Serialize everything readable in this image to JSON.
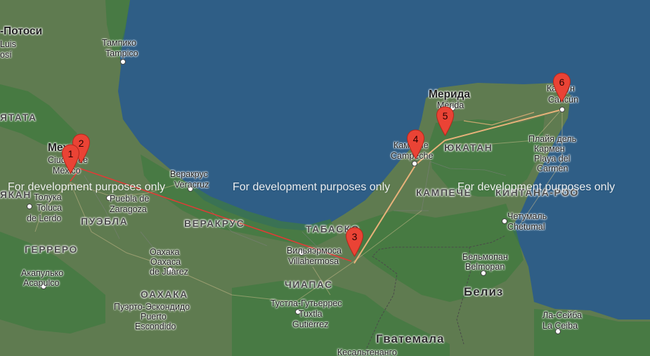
{
  "map": {
    "watermark": "For development purposes only",
    "colors": {
      "water": "#2f5e86",
      "land": "#5d7a4f",
      "forest": "#3f7a3c",
      "route_red": "#e53935",
      "route_tan": "#e8b27a",
      "marker": "#ea4335"
    },
    "markers": [
      {
        "id": 1,
        "label": "1"
      },
      {
        "id": 2,
        "label": "2"
      },
      {
        "id": 3,
        "label": "3"
      },
      {
        "id": 4,
        "label": "4"
      },
      {
        "id": 5,
        "label": "5"
      },
      {
        "id": 6,
        "label": "6"
      }
    ],
    "labels": {
      "san_luis_potosi_1": "-Потоси",
      "san_luis_potosi_2": "Luis",
      "san_luis_potosi_3": "osí",
      "tampico_ru": "Тампико",
      "tampico": "Tampico",
      "mexico_ru": "Мехико",
      "ciudad_de": "Ciudad de",
      "mexico": "México",
      "toluca_ru": "Толука",
      "toluca": "Toluca",
      "de_lerdo": "de Lerdo",
      "puebla_city": "Puebla de",
      "zaragoza": "Zaragoza",
      "veracruz_ru": "Веракрус",
      "veracruz": "Veracruz",
      "state_veracruz": "ВЕРАКРУС",
      "state_puebla": "ПУЭБЛА",
      "state_guerrero": "ГЕРРЕРО",
      "state_oaxaca": "ОАХАКА",
      "state_tabasco": "ТАБАСКО",
      "state_chiapas": "ЧИАПАС",
      "state_campeche": "КАМПЕЧЕ",
      "state_yucatan": "ЮКАТАН",
      "state_quintana_roo": "КИНТАНА-РОО",
      "acapulco_ru": "Акапулько",
      "acapulco": "Acapulco",
      "oaxaca_ru": "Оахака",
      "oaxaca_city": "Oaxaca",
      "de_juarez": "de Juárez",
      "puerto_ru": "Пуэрто-Эскондидо",
      "puerto": "Puerto",
      "escondido": "Escondido",
      "villahermosa_ru": "Вильяэрмоса",
      "villahermosa": "Villahermosa",
      "tuxtla_ru": "Тустла-Гутьеррес",
      "tuxtla": "Tuxtla",
      "gutierrez": "Gutiérrez",
      "campeche_ru": "Кампече",
      "campeche": "Campeche",
      "merida_ru": "Мерида",
      "merida": "Mérida",
      "cancun_ru": "Канкун",
      "cancun": "Cancún",
      "playa_ru_1": "Плайя дель",
      "playa_ru_2": "Кармен",
      "playa_1": "Playa del",
      "playa_2": "Carmen",
      "chetumal_ru": "Четумаль",
      "chetumal": "Chetumal",
      "belmopan_ru": "Бельмопан",
      "belmopan": "Belmopan",
      "belize": "Белиз",
      "guatemala": "Гватемала",
      "quetzaltenango": "Кесальтенанго",
      "la_ceiba_ru": "Ла-Сейба",
      "la_ceiba": "La Ceiba",
      "atlantic": "ЯТАТА",
      "ykan": "ЯКАН"
    }
  }
}
